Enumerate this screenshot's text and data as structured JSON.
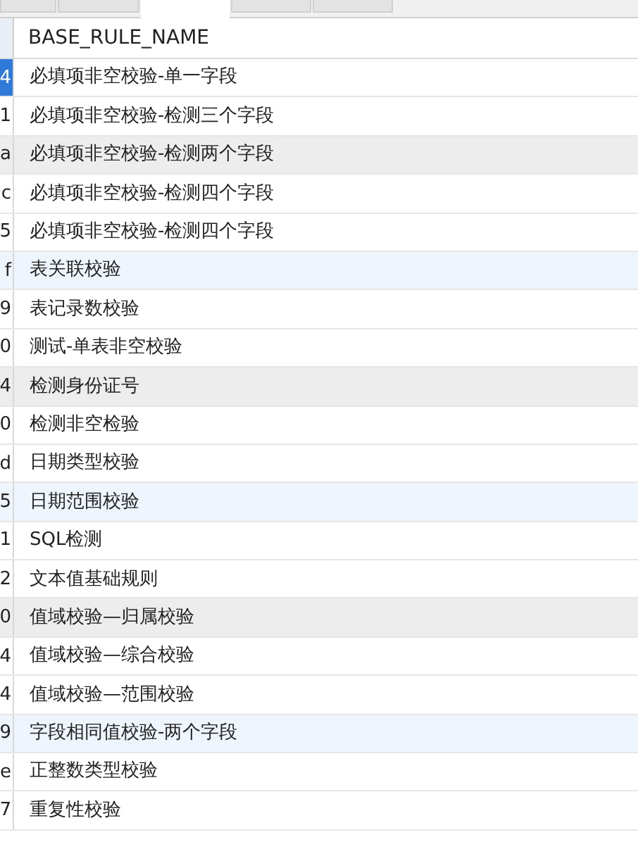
{
  "tabs": [
    {
      "selected": false
    },
    {
      "selected": false
    },
    {
      "selected": true
    },
    {
      "selected": false
    },
    {
      "selected": false
    }
  ],
  "table": {
    "columns": [
      "BASE_RULE_NAME"
    ],
    "rows": [
      {
        "column_1": "4",
        "name": "必填项非空校验-单一字段",
        "selected": true,
        "kind": "plain"
      },
      {
        "column_1": "1",
        "name": "必填项非空校验-检测三个字段",
        "selected": false,
        "kind": "plain"
      },
      {
        "column_1": "a",
        "name": "必填项非空校验-检测两个字段",
        "selected": false,
        "kind": "gray"
      },
      {
        "column_1": "c",
        "name": "必填项非空校验-检测四个字段",
        "selected": false,
        "kind": "plain"
      },
      {
        "column_1": "5",
        "name": "必填项非空校验-检测四个字段",
        "selected": false,
        "kind": "plain"
      },
      {
        "column_1": "f",
        "name": "表关联校验",
        "selected": false,
        "kind": "blue"
      },
      {
        "column_1": "9",
        "name": "表记录数校验",
        "selected": false,
        "kind": "plain"
      },
      {
        "column_1": "0",
        "name": "测试-单表非空校验",
        "selected": false,
        "kind": "plain"
      },
      {
        "column_1": "4",
        "name": "检测身份证号",
        "selected": false,
        "kind": "gray"
      },
      {
        "column_1": "0",
        "name": "检测非空检验",
        "selected": false,
        "kind": "plain"
      },
      {
        "column_1": "d",
        "name": "日期类型校验",
        "selected": false,
        "kind": "plain"
      },
      {
        "column_1": "5",
        "name": "日期范围校验",
        "selected": false,
        "kind": "blue"
      },
      {
        "column_1": "1",
        "name": "SQL检测",
        "selected": false,
        "kind": "plain"
      },
      {
        "column_1": "2",
        "name": "文本值基础规则",
        "selected": false,
        "kind": "plain"
      },
      {
        "column_1": "0",
        "name": "值域校验—归属校验",
        "selected": false,
        "kind": "gray"
      },
      {
        "column_1": "4",
        "name": "值域校验—综合校验",
        "selected": false,
        "kind": "plain"
      },
      {
        "column_1": "4",
        "name": "值域校验—范围校验",
        "selected": false,
        "kind": "plain"
      },
      {
        "column_1": "9",
        "name": "字段相同值校验-两个字段",
        "selected": false,
        "kind": "blue"
      },
      {
        "column_1": "e",
        "name": "正整数类型校验",
        "selected": false,
        "kind": "plain"
      },
      {
        "column_1": "7",
        "name": "重复性校验",
        "selected": false,
        "kind": "plain"
      }
    ]
  }
}
